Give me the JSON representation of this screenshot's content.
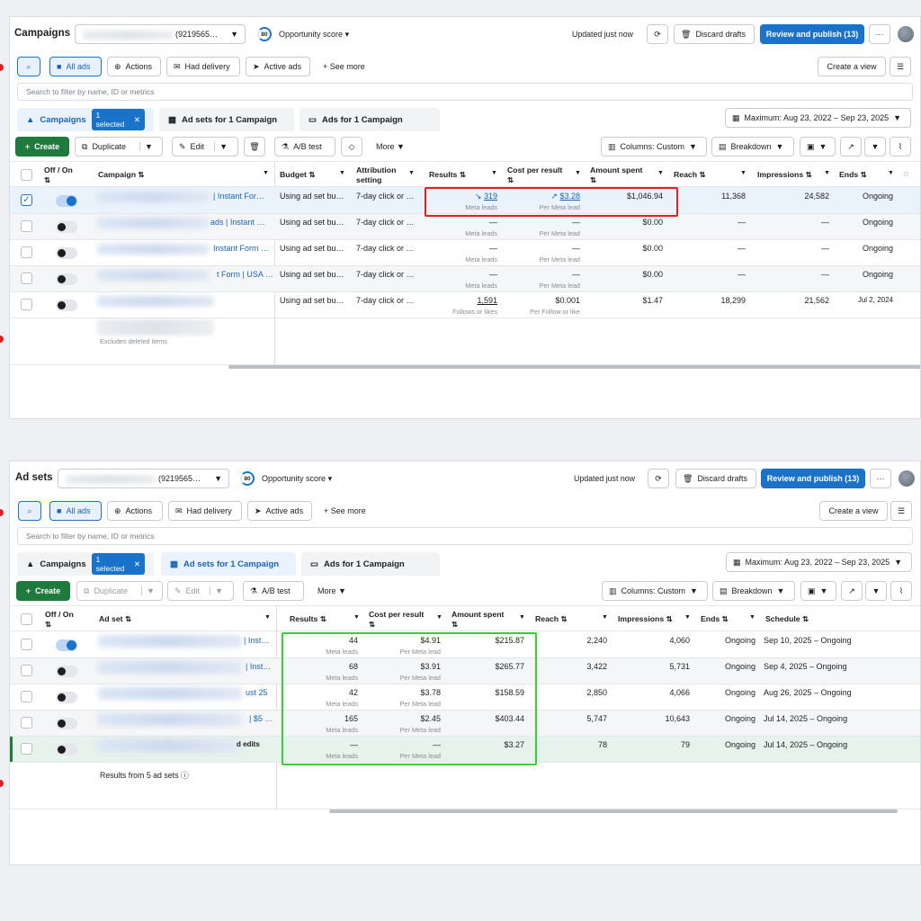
{
  "campaigns_view": {
    "title": "Campaigns",
    "account_suffix": "(9219565…",
    "opportunity_score": "80",
    "opportunity_label": "Opportunity score",
    "updated": "Updated just now",
    "discard": "Discard drafts",
    "review": "Review and publish (13)",
    "filters": {
      "all_ads": "All ads",
      "actions": "Actions",
      "had_delivery": "Had delivery",
      "active_ads": "Active ads",
      "see_more": "See more"
    },
    "create_view": "Create a view",
    "search_placeholder": "Search to filter by name, ID or metrics",
    "tabs": {
      "campaigns": "Campaigns",
      "selected": "1 selected",
      "adsets": "Ad sets for 1 Campaign",
      "ads": "Ads for 1 Campaign"
    },
    "date_range": "Maximum: Aug 23, 2022 – Sep 23, 2025",
    "toolbar": {
      "create": "Create",
      "duplicate": "Duplicate",
      "edit": "Edit",
      "ab_test": "A/B test",
      "more": "More",
      "columns": "Columns: Custom",
      "breakdown": "Breakdown"
    },
    "headers": {
      "onoff": "Off / On",
      "campaign": "Campaign",
      "budget": "Budget",
      "attribution": "Attribution setting",
      "results": "Results",
      "cpr": "Cost per result",
      "amount": "Amount spent",
      "reach": "Reach",
      "impressions": "Impressions",
      "ends": "Ends"
    },
    "rows": [
      {
        "name_tail": "| Instant For…",
        "budget": "Using ad set bu…",
        "attribution": "7-day click or …",
        "results": "319",
        "results_sub": "Meta leads",
        "cpr": "$3.28",
        "cpr_sub": "Per Meta lead",
        "amount": "$1,046.94",
        "reach": "11,368",
        "impressions": "24,582",
        "ends": "Ongoing"
      },
      {
        "name_tail": "ads | Instant …",
        "budget": "Using ad set bu…",
        "attribution": "7-day click or …",
        "results": "—",
        "results_sub": "Meta leads",
        "cpr": "—",
        "cpr_sub": "Per Meta lead",
        "amount": "$0.00",
        "reach": "—",
        "impressions": "—",
        "ends": "Ongoing"
      },
      {
        "name_tail": "Instant Form …",
        "budget": "Using ad set bu…",
        "attribution": "7-day click or …",
        "results": "—",
        "results_sub": "Meta leads",
        "cpr": "—",
        "cpr_sub": "Per Meta lead",
        "amount": "$0.00",
        "reach": "—",
        "impressions": "—",
        "ends": "Ongoing"
      },
      {
        "name_tail": "t Form | USA …",
        "budget": "Using ad set bu…",
        "attribution": "7-day click or …",
        "results": "—",
        "results_sub": "Meta leads",
        "cpr": "—",
        "cpr_sub": "Per Meta lead",
        "amount": "$0.00",
        "reach": "—",
        "impressions": "—",
        "ends": "Ongoing"
      },
      {
        "name_tail": "",
        "budget": "Using ad set bu…",
        "attribution": "7-day click or …",
        "results": "1,591",
        "results_sub": "Follows or likes",
        "cpr": "$0.001",
        "cpr_sub": "Per Follow or like",
        "amount": "$1.47",
        "reach": "18,299",
        "impressions": "21,562",
        "ends": "Jul 2, 2024"
      }
    ],
    "footer": "Excludes deleted items"
  },
  "adsets_view": {
    "title": "Ad sets",
    "account_suffix": "(9219565…",
    "opportunity_score": "80",
    "opportunity_label": "Opportunity score",
    "updated": "Updated just now",
    "discard": "Discard drafts",
    "review": "Review and publish (13)",
    "filters": {
      "all_ads": "All ads",
      "actions": "Actions",
      "had_delivery": "Had delivery",
      "active_ads": "Active ads",
      "see_more": "See more"
    },
    "create_view": "Create a view",
    "search_placeholder": "Search to filter by name, ID or metrics",
    "tabs": {
      "campaigns": "Campaigns",
      "selected": "1 selected",
      "adsets": "Ad sets for 1 Campaign",
      "ads": "Ads for 1 Campaign"
    },
    "date_range": "Maximum: Aug 23, 2022 – Sep 23, 2025",
    "toolbar": {
      "create": "Create",
      "duplicate": "Duplicate",
      "edit": "Edit",
      "ab_test": "A/B test",
      "more": "More",
      "columns": "Columns: Custom",
      "breakdown": "Breakdown"
    },
    "headers": {
      "onoff": "Off / On",
      "adset": "Ad set",
      "results": "Results",
      "cpr": "Cost per result",
      "amount": "Amount spent",
      "reach": "Reach",
      "impressions": "Impressions",
      "ends": "Ends",
      "schedule": "Schedule"
    },
    "rows": [
      {
        "name_tail": "| Inst…",
        "results": "44",
        "cpr": "$4.91",
        "amount": "$215.87",
        "reach": "2,240",
        "impressions": "4,060",
        "ends": "Ongoing",
        "schedule": "Sep 10, 2025 – Ongoing"
      },
      {
        "name_tail": "| Inst…",
        "results": "68",
        "cpr": "$3.91",
        "amount": "$265.77",
        "reach": "3,422",
        "impressions": "5,731",
        "ends": "Ongoing",
        "schedule": "Sep 4, 2025 – Ongoing"
      },
      {
        "name_tail": "ust 25",
        "results": "42",
        "cpr": "$3.78",
        "amount": "$158.59",
        "reach": "2,850",
        "impressions": "4,066",
        "ends": "Ongoing",
        "schedule": "Aug 26, 2025 – Ongoing"
      },
      {
        "name_tail": "| $5 …",
        "results": "165",
        "cpr": "$2.45",
        "amount": "$403.44",
        "reach": "5,747",
        "impressions": "10,643",
        "ends": "Ongoing",
        "schedule": "Jul 14, 2025 – Ongoing"
      },
      {
        "name_tail": "d edits",
        "results": "—",
        "cpr": "—",
        "amount": "$3.27",
        "reach": "78",
        "impressions": "79",
        "ends": "Ongoing",
        "schedule": "Jul 14, 2025 – Ongoing"
      }
    ],
    "results_sub": "Meta leads",
    "cpr_sub": "Per Meta lead",
    "footer": "Results from 5 ad sets"
  },
  "colors": {
    "primary": "#1a73c9",
    "create_green": "#1f7a3d",
    "highlight_red": "#e02020",
    "highlight_green": "#37d133"
  }
}
